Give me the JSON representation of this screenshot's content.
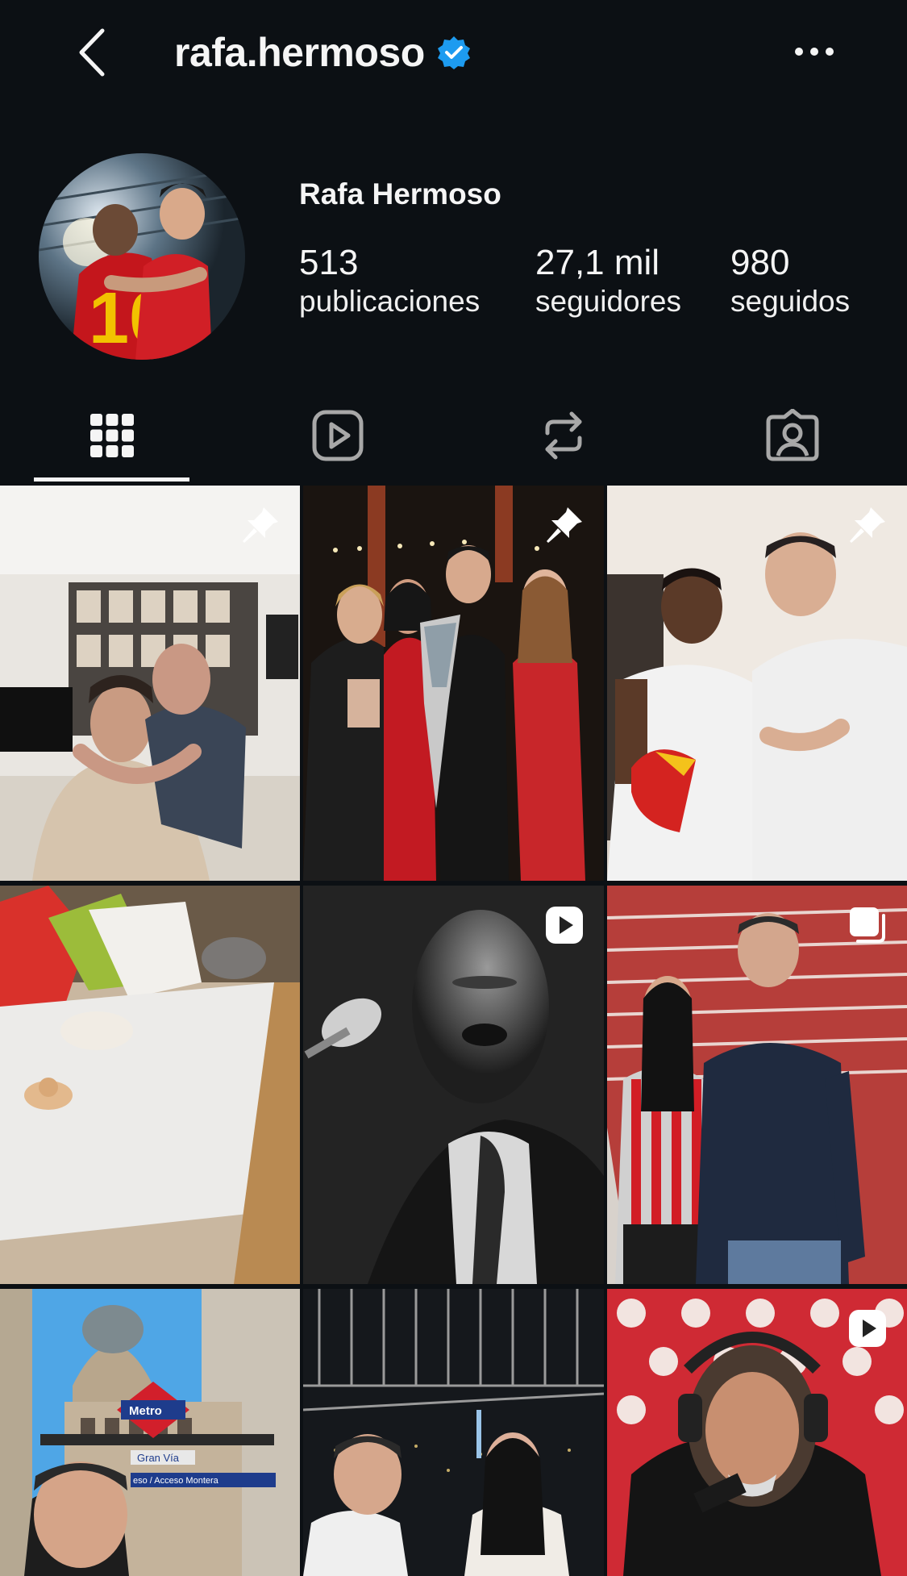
{
  "header": {
    "username": "rafa.hermoso",
    "verified": true,
    "accent_color": "#0095f6"
  },
  "profile": {
    "display_name": "Rafa Hermoso",
    "stats": [
      {
        "value": "513",
        "label": "publicaciones"
      },
      {
        "value": "27,1 mil",
        "label": "seguidores"
      },
      {
        "value": "980",
        "label": "seguidos"
      }
    ]
  },
  "tabs": [
    {
      "icon": "grid-icon",
      "active": true
    },
    {
      "icon": "reels-icon",
      "active": false
    },
    {
      "icon": "reposts-icon",
      "active": false
    },
    {
      "icon": "tagged-icon",
      "active": false
    }
  ],
  "posts": [
    {
      "badge": "pin-icon"
    },
    {
      "badge": "pin-icon"
    },
    {
      "badge": "pin-icon"
    },
    {
      "badge": ""
    },
    {
      "badge": "reel-icon"
    },
    {
      "badge": "carousel-icon"
    },
    {
      "badge": "",
      "signs": {
        "metro": "Metro",
        "street": "Gran Vía",
        "access": "eso / Acceso Montera"
      }
    },
    {
      "badge": ""
    },
    {
      "badge": "reel-icon"
    }
  ]
}
